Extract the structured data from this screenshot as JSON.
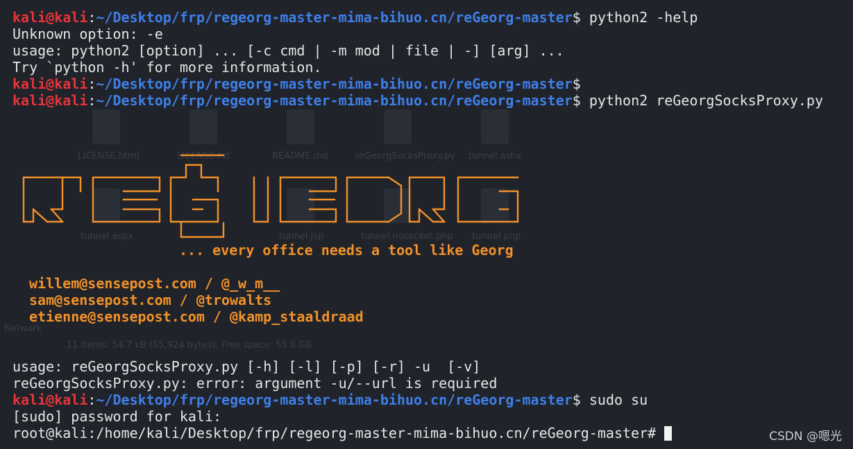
{
  "prompt": {
    "user_host": "kali@kali",
    "separator": ":",
    "path": "~/Desktop/frp/regeorg-master-mima-bihuo.cn/reGeorg-master",
    "symbol": "$ "
  },
  "commands": {
    "c1": "python2 -help",
    "c2": "",
    "c3": "python2 reGeorgSocksProxy.py",
    "c4": "sudo su"
  },
  "output": {
    "unknown": "Unknown option: -e",
    "usage_py": "usage: python2 [option] ... [-c cmd | -m mod | file | -] [arg] ...",
    "try": "Try `python -h' for more information.",
    "tagline": "... every office needs a tool like Georg",
    "credit1": "willem@sensepost.com / @_w_m__",
    "credit2": "sam@sensepost.com / @trowalts",
    "credit3": "etienne@sensepost.com / @kamp_staaldraad",
    "usage_rg": "usage: reGeorgSocksProxy.py [-h] [-l] [-p] [-r] -u  [-v]",
    "error": "reGeorgSocksProxy.py: error: argument -u/--url is required",
    "sudo_pw": "[sudo] password for kali:",
    "root_prompt": "root@kali:/home/kali/Desktop/frp/regeorg-master-mima-bihuo.cn/reGeorg-master# "
  },
  "ascii_banner": [
    "          _____",
    "  _____   ____  ____|__ __|_   _____   _____   _____  _____",
    " |     | |    ___||    ___|    ||  ___|/     \\|     |  |    ___|",
    " |     \\ |    ___||   |   |    ||  ___|       |     \\  |   |  |",
    " |__|\\__\\|_______||_______|  __||_______|\\_____/|__|\\__\\|______|",
    "                        |_______|"
  ],
  "background_ghost": {
    "labels": [
      "LICENSE.html",
      "LICENSE.txt",
      "README.md",
      "reGeorgSocksProxy.py",
      "tunnel.ashx",
      "tunnel.aspx",
      "tunnel.jsp",
      "tunnel.nosocket.php",
      "tunnel.php",
      "Network",
      "11 items: 54.7 kB (55,924 bytes), Free space: 55.6 GB"
    ]
  },
  "watermark": "CSDN @嗯光",
  "colors": {
    "background": "#20232a",
    "user": "#e8343a",
    "path": "#3f7fe8",
    "banner": "#f29228",
    "text": "#e6e6e6"
  }
}
